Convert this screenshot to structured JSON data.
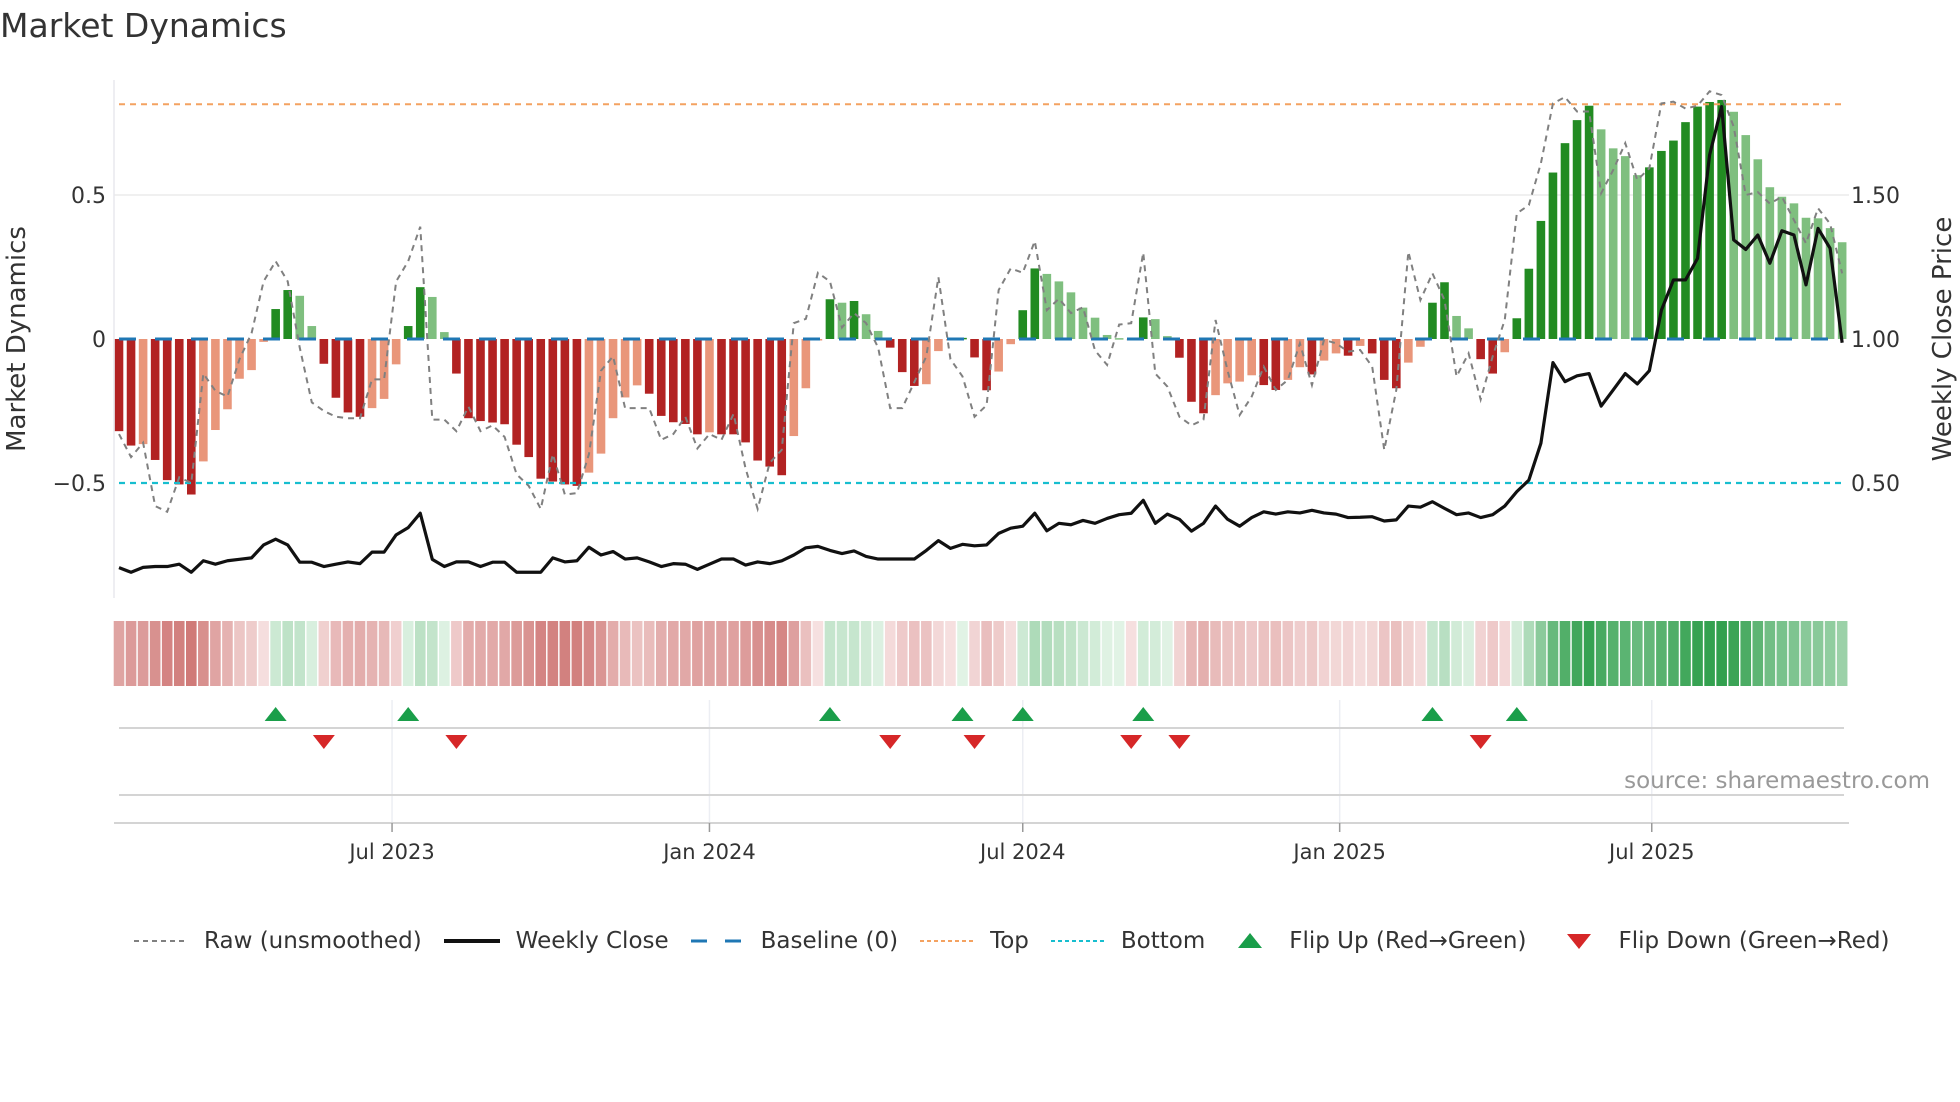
{
  "title": "Market Dynamics",
  "source": "source: sharemaestro.com",
  "legend": [
    {
      "label": "Raw (unsmoothed)",
      "icon": "dashed-gray-line"
    },
    {
      "label": "Weekly Close",
      "icon": "solid-black-line"
    },
    {
      "label": "Baseline (0)",
      "icon": "dashed-blue-line"
    },
    {
      "label": "Top",
      "icon": "dotted-orange-line"
    },
    {
      "label": "Bottom",
      "icon": "dotted-cyan-line"
    },
    {
      "label": "Flip Up (Red→Green)",
      "icon": "triangle-up"
    },
    {
      "label": "Flip Down (Green→Red)",
      "icon": "triangle-down"
    }
  ],
  "colors": {
    "pos_strong": "#228b22",
    "pos_weak": "#7fbf7f",
    "neg_strong": "#b22222",
    "neg_weak": "#e9967a",
    "baseline": "#1f77b4",
    "top": "#f4a261",
    "bottom": "#17becf",
    "raw": "#808080",
    "close": "#111111",
    "flip_up": "#1a9e4a",
    "flip_down": "#d62728"
  },
  "chart_data": {
    "type": "bar",
    "title": "Market Dynamics",
    "ylabel": "Market Dynamics",
    "ylabel_right": "Weekly Close Price",
    "xlabel": "",
    "ylim": [
      -0.82,
      0.92
    ],
    "ylim_right": [
      0.18,
      1.92
    ],
    "yticks_left": [
      {
        "value": 0.5,
        "label": "0.5"
      },
      {
        "value": 0,
        "label": "0"
      },
      {
        "value": -0.5,
        "label": "−0.5"
      }
    ],
    "yticks_right": [
      {
        "value": 1.5,
        "label": "1.50"
      },
      {
        "value": 1.0,
        "label": "1.00"
      },
      {
        "value": 0.5,
        "label": "0.50"
      }
    ],
    "x_ticks": [
      {
        "label": "Jul 2023",
        "week": 22.66
      },
      {
        "label": "Jan 2024",
        "week": 49.0
      },
      {
        "label": "Jul 2024",
        "week": 75.0
      },
      {
        "label": "Jan 2025",
        "week": 101.3
      },
      {
        "label": "Jul 2025",
        "week": 127.2
      }
    ],
    "grid": true,
    "legend_position": "bottom",
    "baseline": 0,
    "top": 0.815,
    "bottom": -0.5,
    "series": [
      {
        "name": "Market Dynamics (smoothed)",
        "type": "bar",
        "values": [
          -0.32,
          -0.37,
          -0.365,
          -0.42,
          -0.49,
          -0.505,
          -0.54,
          -0.425,
          -0.316,
          -0.244,
          -0.138,
          -0.108,
          -0.01,
          0.104,
          0.17,
          0.15,
          0.045,
          -0.086,
          -0.204,
          -0.255,
          -0.27,
          -0.24,
          -0.208,
          -0.088,
          0.045,
          0.18,
          0.146,
          0.024,
          -0.12,
          -0.275,
          -0.285,
          -0.29,
          -0.296,
          -0.367,
          -0.41,
          -0.485,
          -0.495,
          -0.505,
          -0.51,
          -0.464,
          -0.398,
          -0.275,
          -0.203,
          -0.161,
          -0.19,
          -0.267,
          -0.289,
          -0.295,
          -0.331,
          -0.324,
          -0.331,
          -0.331,
          -0.359,
          -0.422,
          -0.443,
          -0.473,
          -0.337,
          -0.171,
          -0.001,
          0.138,
          0.126,
          0.132,
          0.086,
          0.028,
          -0.03,
          -0.115,
          -0.163,
          -0.157,
          -0.042,
          -0.003,
          0.004,
          -0.064,
          -0.178,
          -0.113,
          -0.018,
          0.1,
          0.245,
          0.226,
          0.2,
          0.162,
          0.109,
          0.074,
          0.014,
          0.003,
          -0.004,
          0.075,
          0.069,
          0.01,
          -0.065,
          -0.218,
          -0.258,
          -0.195,
          -0.154,
          -0.148,
          -0.126,
          -0.16,
          -0.177,
          -0.142,
          -0.098,
          -0.123,
          -0.075,
          -0.05,
          -0.058,
          -0.024,
          -0.05,
          -0.142,
          -0.171,
          -0.082,
          -0.027,
          0.126,
          0.197,
          0.08,
          0.037,
          -0.07,
          -0.12,
          -0.046,
          0.072,
          0.244,
          0.41,
          0.578,
          0.68,
          0.76,
          0.81,
          0.728,
          0.662,
          0.635,
          0.569,
          0.596,
          0.653,
          0.689,
          0.753,
          0.807,
          0.823,
          0.83,
          0.789,
          0.708,
          0.624,
          0.527,
          0.494,
          0.471,
          0.421,
          0.419,
          0.385,
          0.336
        ]
      },
      {
        "name": "Raw (unsmoothed)",
        "type": "line",
        "values": [
          -0.33,
          -0.41,
          -0.36,
          -0.58,
          -0.6,
          -0.48,
          -0.5,
          -0.12,
          -0.18,
          -0.2,
          -0.07,
          0.02,
          0.2,
          0.27,
          0.2,
          -0.03,
          -0.22,
          -0.25,
          -0.27,
          -0.275,
          -0.275,
          -0.14,
          -0.14,
          0.2,
          0.27,
          0.39,
          -0.28,
          -0.28,
          -0.32,
          -0.235,
          -0.32,
          -0.3,
          -0.34,
          -0.47,
          -0.51,
          -0.59,
          -0.4,
          -0.54,
          -0.535,
          -0.4,
          -0.11,
          -0.06,
          -0.24,
          -0.24,
          -0.24,
          -0.35,
          -0.33,
          -0.27,
          -0.38,
          -0.33,
          -0.35,
          -0.26,
          -0.45,
          -0.59,
          -0.43,
          -0.385,
          0.055,
          0.07,
          0.23,
          0.2,
          0.04,
          0.09,
          0.055,
          -0.03,
          -0.24,
          -0.24,
          -0.15,
          -0.06,
          0.215,
          -0.07,
          -0.13,
          -0.27,
          -0.23,
          0.17,
          0.245,
          0.23,
          0.34,
          0.1,
          0.14,
          0.09,
          0.11,
          -0.04,
          -0.09,
          0.05,
          0.055,
          0.3,
          -0.12,
          -0.165,
          -0.27,
          -0.3,
          -0.28,
          0.066,
          -0.11,
          -0.264,
          -0.2,
          -0.096,
          -0.177,
          -0.142,
          -0.015,
          -0.16,
          -0.003,
          -0.015,
          -0.044,
          -0.038,
          -0.096,
          -0.385,
          -0.177,
          0.303,
          0.135,
          0.228,
          0.135,
          -0.13,
          -0.05,
          -0.21,
          -0.06,
          0.066,
          0.436,
          0.465,
          0.61,
          0.818,
          0.84,
          0.79,
          0.79,
          0.506,
          0.587,
          0.68,
          0.552,
          0.593,
          0.818,
          0.824,
          0.8,
          0.81,
          0.86,
          0.847,
          0.737,
          0.5,
          0.51,
          0.47,
          0.494,
          0.413,
          0.332,
          0.454,
          0.4,
          0.228
        ]
      },
      {
        "name": "Weekly Close",
        "type": "line",
        "axis": "right",
        "values": [
          0.206,
          0.19,
          0.207,
          0.21,
          0.21,
          0.218,
          0.19,
          0.23,
          0.218,
          0.23,
          0.235,
          0.24,
          0.285,
          0.305,
          0.285,
          0.225,
          0.225,
          0.21,
          0.218,
          0.226,
          0.22,
          0.26,
          0.26,
          0.32,
          0.345,
          0.395,
          0.235,
          0.21,
          0.226,
          0.226,
          0.21,
          0.225,
          0.225,
          0.19,
          0.19,
          0.19,
          0.24,
          0.226,
          0.23,
          0.277,
          0.25,
          0.262,
          0.236,
          0.24,
          0.226,
          0.21,
          0.22,
          0.218,
          0.2,
          0.218,
          0.236,
          0.236,
          0.215,
          0.226,
          0.22,
          0.23,
          0.25,
          0.275,
          0.28,
          0.266,
          0.255,
          0.264,
          0.245,
          0.236,
          0.236,
          0.236,
          0.236,
          0.266,
          0.3,
          0.273,
          0.287,
          0.282,
          0.285,
          0.325,
          0.343,
          0.35,
          0.395,
          0.334,
          0.36,
          0.355,
          0.37,
          0.36,
          0.377,
          0.39,
          0.395,
          0.44,
          0.36,
          0.392,
          0.374,
          0.333,
          0.36,
          0.42,
          0.374,
          0.35,
          0.38,
          0.4,
          0.392,
          0.4,
          0.396,
          0.405,
          0.396,
          0.392,
          0.38,
          0.381,
          0.383,
          0.368,
          0.372,
          0.42,
          0.416,
          0.435,
          0.412,
          0.39,
          0.396,
          0.38,
          0.39,
          0.42,
          0.47,
          0.51,
          0.638,
          0.918,
          0.852,
          0.872,
          0.88,
          0.767,
          0.823,
          0.88,
          0.844,
          0.89,
          1.1,
          1.205,
          1.205,
          1.28,
          1.639,
          1.807,
          1.344,
          1.311,
          1.361,
          1.263,
          1.376,
          1.361,
          1.188,
          1.384,
          1.315,
          0.987
        ]
      }
    ]
  }
}
